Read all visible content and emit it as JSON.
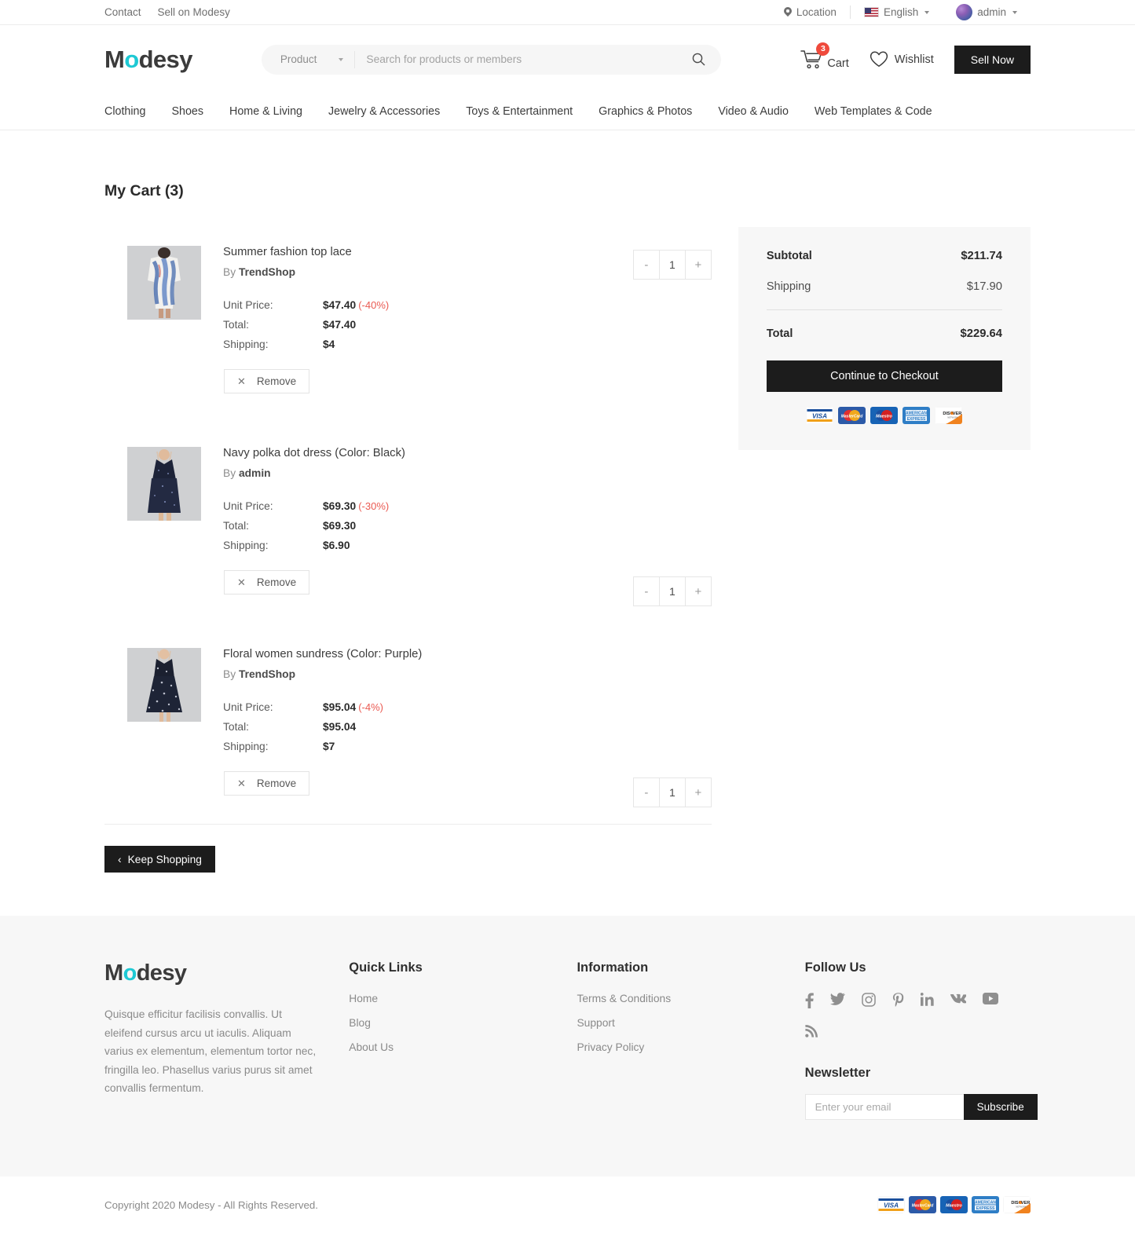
{
  "topbar": {
    "links": [
      "Contact",
      "Sell on Modesy"
    ],
    "location": "Location",
    "language": "English",
    "account": "admin"
  },
  "header": {
    "logo_pre": "M",
    "logo_o": "o",
    "logo_post": "desy",
    "search_category": "Product",
    "search_placeholder": "Search for products or members",
    "cart_label": "Cart",
    "cart_count": "3",
    "wishlist_label": "Wishlist",
    "sell_now_label": "Sell Now"
  },
  "nav": {
    "items": [
      "Clothing",
      "Shoes",
      "Home & Living",
      "Jewelry & Accessories",
      "Toys & Entertainment",
      "Graphics & Photos",
      "Video & Audio",
      "Web Templates & Code"
    ]
  },
  "cart": {
    "title": "My Cart (3)",
    "labels": {
      "unit_price": "Unit Price:",
      "total": "Total:",
      "shipping": "Shipping:",
      "remove": "Remove",
      "by": "By"
    },
    "items": [
      {
        "name": "Summer fashion top lace",
        "seller": "TrendShop",
        "unit_price": "$47.40",
        "discount": "(-40%)",
        "total": "$47.40",
        "shipping": "$4",
        "qty": "1"
      },
      {
        "name": "Navy polka dot dress (Color: Black)",
        "seller": "admin",
        "unit_price": "$69.30",
        "discount": "(-30%)",
        "total": "$69.30",
        "shipping": "$6.90",
        "qty": "1"
      },
      {
        "name": "Floral women sundress (Color: Purple)",
        "seller": "TrendShop",
        "unit_price": "$95.04",
        "discount": "(-4%)",
        "total": "$95.04",
        "shipping": "$7",
        "qty": "1"
      }
    ],
    "keep_shopping_label": "Keep Shopping"
  },
  "summary": {
    "subtotal_label": "Subtotal",
    "subtotal_value": "$211.74",
    "shipping_label": "Shipping",
    "shipping_value": "$17.90",
    "total_label": "Total",
    "total_value": "$229.64",
    "checkout_label": "Continue to Checkout",
    "payment_cards": [
      "VISA",
      "MasterCard",
      "Maestro",
      "AMERICAN EXPRESS",
      "DISCOVER"
    ]
  },
  "footer": {
    "logo_pre": "M",
    "logo_o": "o",
    "logo_post": "desy",
    "description": "Quisque efficitur facilisis convallis. Ut eleifend cursus arcu ut iaculis. Aliquam varius ex elementum, elementum tortor nec, fringilla leo. Phasellus varius purus sit amet convallis fermentum.",
    "quick_links_head": "Quick Links",
    "quick_links": [
      "Home",
      "Blog",
      "About Us"
    ],
    "information_head": "Information",
    "information": [
      "Terms & Conditions",
      "Support",
      "Privacy Policy"
    ],
    "follow_head": "Follow Us",
    "social": [
      "facebook",
      "twitter",
      "instagram",
      "pinterest",
      "linkedin",
      "vk",
      "youtube",
      "rss"
    ],
    "newsletter_head": "Newsletter",
    "newsletter_placeholder": "Enter your email",
    "subscribe_label": "Subscribe",
    "copyright": "Copyright 2020 Modesy - All Rights Reserved."
  },
  "colors": {
    "accent": "#1ec9d4",
    "dark": "#1c1c1c",
    "badge": "#ef4a3c",
    "discount": "#ea5a52",
    "panel": "#f7f7f7"
  }
}
